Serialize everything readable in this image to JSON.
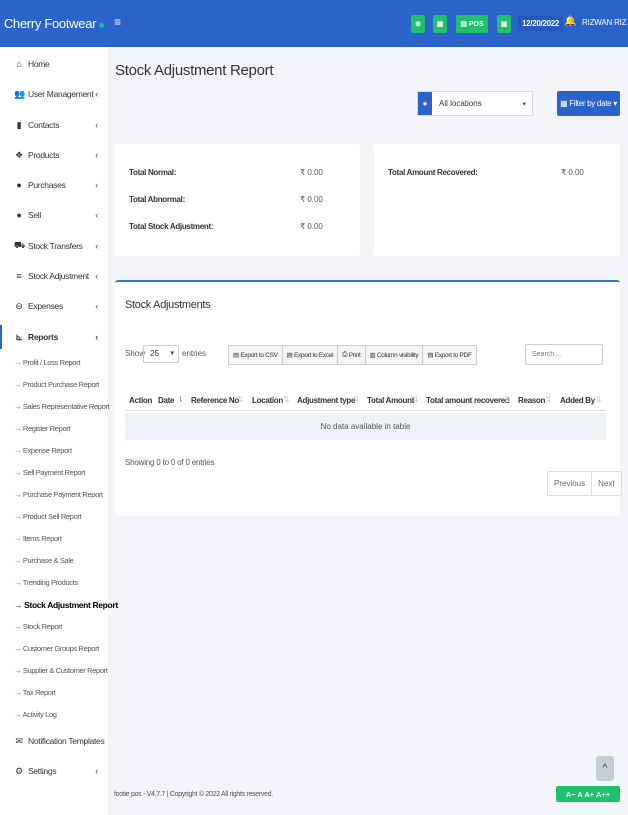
{
  "brand": {
    "name": "Cherry Footwear"
  },
  "topbar": {
    "menu_icon": "hamburger-icon",
    "pos_label": "POS",
    "date": "12/20/2022",
    "user": "RIZWAN RIZ"
  },
  "sidebar": {
    "items": [
      {
        "label": "Home",
        "icon": "home-icon"
      },
      {
        "label": "User Management",
        "icon": "users-icon"
      },
      {
        "label": "Contacts",
        "icon": "address-book-icon"
      },
      {
        "label": "Products",
        "icon": "cubes-icon"
      },
      {
        "label": "Purchases",
        "icon": "arrow-circle-down-icon"
      },
      {
        "label": "Sell",
        "icon": "arrow-circle-up-icon"
      },
      {
        "label": "Stock Transfers",
        "icon": "truck-icon"
      },
      {
        "label": "Stock Adjustment",
        "icon": "database-icon"
      },
      {
        "label": "Expenses",
        "icon": "minus-circle-icon"
      },
      {
        "label": "Reports",
        "icon": "chart-icon"
      },
      {
        "label": "Notification Templates",
        "icon": "envelope-icon"
      },
      {
        "label": "Settings",
        "icon": "cog-icon"
      }
    ],
    "report_items": [
      "→ Profit / Loss Report",
      "→ Product Purchase Report",
      "→ Sales Representative Report",
      "→ Register Report",
      "→ Expense Report",
      "→ Sell Payment Report",
      "→ Purchase Payment Report",
      "→ Product Sell Report",
      "→ Items Report",
      "→ Purchase & Sale",
      "→ Trending Products",
      "→ Stock Adjustment Report",
      "→ Stock Report",
      "→ Customer Groups Report",
      "→ Supplier & Customer Report",
      "→ Tax Report",
      "→ Activity Log"
    ]
  },
  "main": {
    "title": "Stock Adjustment Report",
    "location": "All locations",
    "filter_label": "Filter by date"
  },
  "summary": {
    "total_normal_label": "Total Normal:",
    "total_normal": "₹ 0.00",
    "total_abnormal_label": "Total Abnormal:",
    "total_abnormal": "₹ 0.00",
    "total_adj_label": "Total Stock Adjustment:",
    "total_adj": "₹ 0.00",
    "recovered_label": "Total Amount Recovered:",
    "recovered": "₹ 0.00"
  },
  "table_section": {
    "title": "Stock Adjustments",
    "show_label": "Show",
    "entries_value": "25",
    "entries_label": "entries",
    "export_buttons": [
      "Export to CSV",
      "Export to Excel",
      "Print",
      "Column visibility",
      "Export to PDF"
    ],
    "search_placeholder": "Search ...",
    "columns": [
      "Action",
      "Date",
      "Reference No",
      "Location",
      "Adjustment type",
      "Total Amount",
      "Total amount recovered",
      "Reason",
      "Added By"
    ],
    "empty_text": "No data available in table",
    "info": "Showing 0 to 0 of 0 entries",
    "prev": "Previous",
    "next": "Next"
  },
  "footer": {
    "text": "footie pos - V4.7.7 | Copyright © 2022 All rights reserved."
  },
  "font_controls": "A− A A+ A++",
  "colors": {
    "primary": "#2a63c9",
    "success": "#1fc16b"
  }
}
